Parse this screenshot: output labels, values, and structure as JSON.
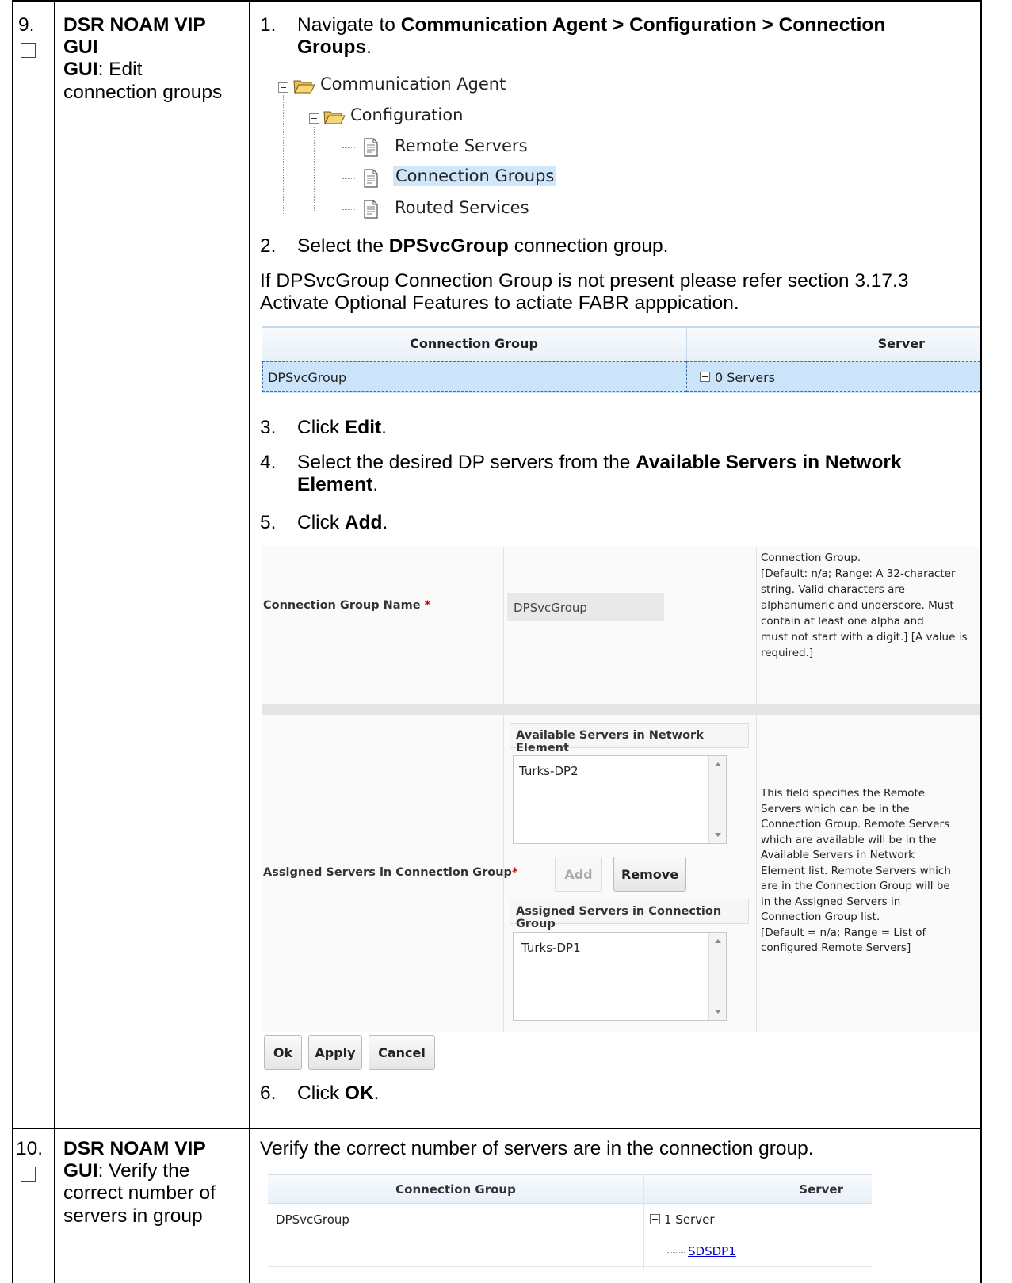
{
  "steps": [
    {
      "number": "9.",
      "title_bold": "DSR NOAM VIP GUI",
      "title_rest_line1": ": Edit",
      "title_line2": "connection groups",
      "instructions": {
        "s1_num": "1.",
        "s1_prefix": "Navigate to ",
        "s1_bold_line1": "Communication Agent > Configuration > Connection",
        "s1_bold_line2": "Groups",
        "s1_suffix": ".",
        "tree": {
          "root": "Communication Agent",
          "child": "Configuration",
          "leaves": [
            "Remote Servers",
            "Connection Groups",
            "Routed Services"
          ]
        },
        "s2_num": "2.",
        "s2_prefix": "Select the ",
        "s2_bold": "DPSvcGroup",
        "s2_suffix": " connection group.",
        "note_line1": "If DPSvcGroup Connection Group is not present please refer section 3.17.3",
        "note_line2": "Activate Optional Features to actiate FABR apppication.",
        "group_table": {
          "col1": "Connection Group",
          "col2": "Server",
          "row_group": "DPSvcGroup",
          "row_server": "0 Servers"
        },
        "s3_num": "3.",
        "s3_prefix": "Click ",
        "s3_bold": "Edit",
        "s3_suffix": ".",
        "s4_num": "4.",
        "s4_prefix": "Select the desired DP servers from the ",
        "s4_bold_line1": "Available Servers in Network",
        "s4_bold_line2": "Element",
        "s4_suffix": ".",
        "s5_num": "5.",
        "s5_prefix": "Click ",
        "s5_bold": "Add",
        "s5_suffix": ".",
        "edit_form": {
          "name_label": "Connection Group Name",
          "required_mark": "*",
          "name_value": "DPSvcGroup",
          "name_help": [
            "Connection Group.",
            "[Default: n/a; Range: A 32-character",
            "string. Valid characters are",
            "alphanumeric and underscore. Must",
            "contain at least one alpha and",
            "must not start with a digit.] [A value is",
            "required.]"
          ],
          "assigned_label": "Assigned Servers in Connection Group",
          "available_header": "Available Servers in Network Element",
          "available_items": [
            "Turks-DP2"
          ],
          "add_button": "Add",
          "remove_button": "Remove",
          "assigned_header": "Assigned Servers in Connection Group",
          "assigned_items": [
            "Turks-DP1"
          ],
          "assigned_help": [
            "This field specifies the Remote",
            "Servers which can be in the",
            "Connection Group. Remote Servers",
            "which are available will be in the",
            "Available Servers in Network",
            "Element list. Remote Servers which",
            "are in the Connection Group will be",
            "in the Assigned Servers in",
            "Connection Group list.",
            "[Default = n/a; Range = List of",
            "configured Remote Servers]"
          ],
          "ok_button": "Ok",
          "apply_button": "Apply",
          "cancel_button": "Cancel"
        },
        "s6_num": "6.",
        "s6_prefix": "Click ",
        "s6_bold": "OK",
        "s6_suffix": "."
      }
    },
    {
      "number": "10.",
      "title_bold": "DSR NOAM VIP",
      "title_line2_bold": "GUI",
      "title_line2_rest": ": Verify the",
      "title_line3": "correct number of",
      "title_line4": "servers in group",
      "instruction": "Verify the correct number of servers are in the connection group.",
      "verify_table": {
        "col1": "Connection Group",
        "col2": "Server",
        "row_group": "DPSvcGroup",
        "row_server": "1 Server",
        "child_link": "SDSDP1"
      }
    }
  ],
  "colors": {
    "selected_row": "#cce4fa",
    "selection_text_bg": "#cfe6fb",
    "link": "#0000cc",
    "required": "#cc0000"
  }
}
